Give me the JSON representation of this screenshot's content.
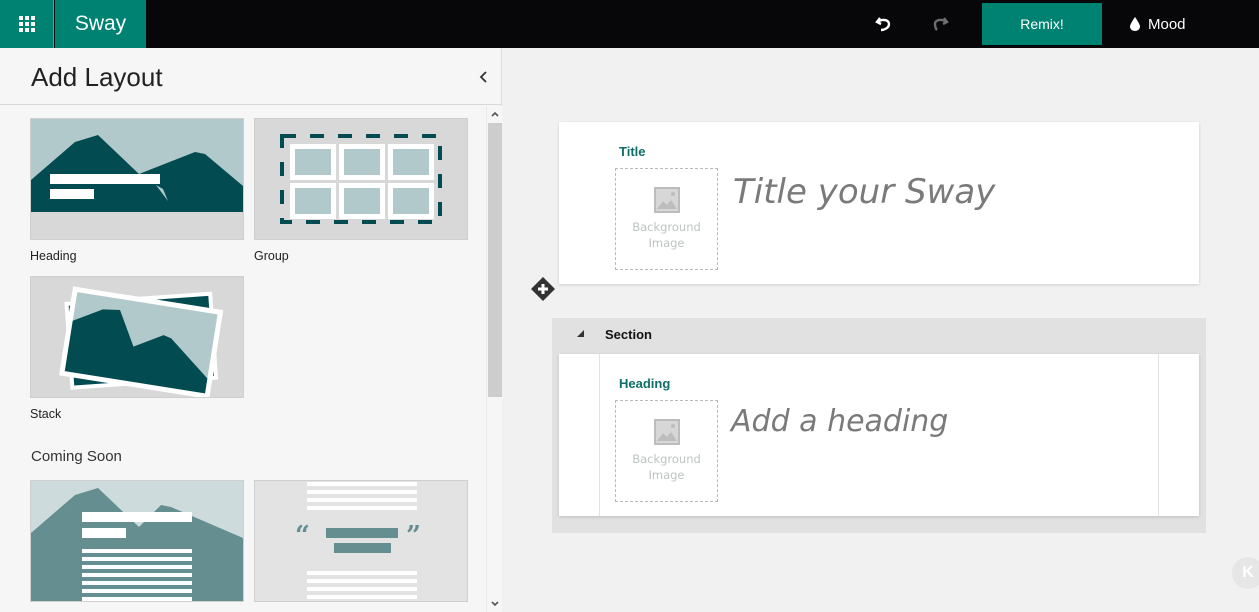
{
  "app": {
    "brand": "Sway",
    "apps_icon": "app-launcher-grid-icon"
  },
  "toolbar": {
    "undo_icon": "undo-icon",
    "redo_icon": "redo-icon",
    "remix_label": "Remix!",
    "mood_label": "Mood",
    "mood_icon": "droplet-icon"
  },
  "panel": {
    "title": "Add Layout",
    "collapse_icon": "chevron-left-icon",
    "layouts": [
      {
        "label": "Heading",
        "thumbnail": "heading-thumbnail"
      },
      {
        "label": "Group",
        "thumbnail": "group-thumbnail"
      },
      {
        "label": "Stack",
        "thumbnail": "stack-thumbnail"
      }
    ],
    "coming_soon_label": "Coming Soon",
    "coming_soon": [
      {
        "thumbnail": "text-over-image-thumbnail"
      },
      {
        "thumbnail": "quote-thumbnail"
      }
    ]
  },
  "canvas": {
    "title_card": {
      "tag": "Title",
      "bg_image_line1": "Background",
      "bg_image_line2": "Image",
      "placeholder": "Title your Sway"
    },
    "add_icon": "add-content-icon",
    "section": {
      "label": "Section",
      "heading_card": {
        "tag": "Heading",
        "bg_image_line1": "Background",
        "bg_image_line2": "Image",
        "placeholder": "Add a heading"
      }
    },
    "accessibility_hint": "K"
  },
  "colors": {
    "accent": "#008272",
    "topbar": "#070709",
    "dark_teal": "#024b51",
    "light_teal": "#b2c9cb",
    "tag_text": "#0e6f68"
  }
}
